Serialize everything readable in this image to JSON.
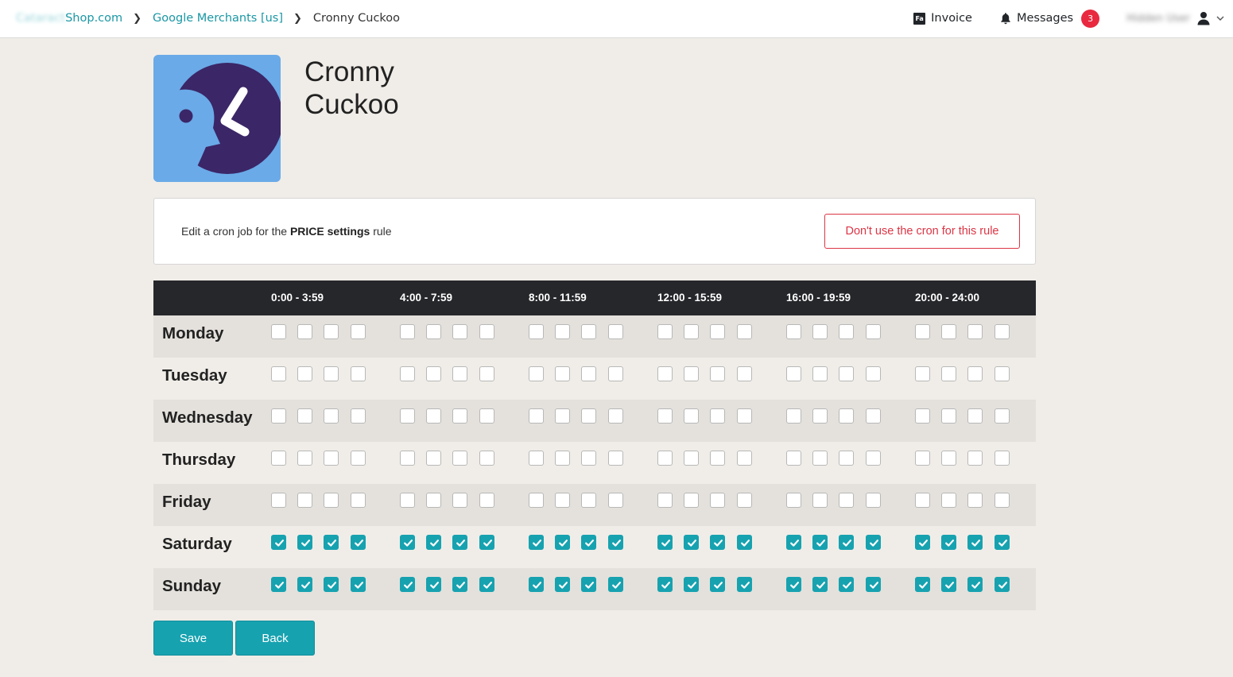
{
  "breadcrumb": {
    "shop_prefix": "Cataract",
    "shop_suffix": "Shop.com",
    "merchant": "Google Merchants [us]",
    "current": "Cronny Cuckoo"
  },
  "topnav": {
    "invoice_label": "Invoice",
    "messages_label": "Messages",
    "messages_count": "3",
    "user_name": "Hidden User"
  },
  "app": {
    "title": "Cronny Cuckoo"
  },
  "card": {
    "text_before": "Edit a cron job for the",
    "text_bold": "PRICE settings",
    "text_after": "rule",
    "disable_button": "Don't use the cron for this rule"
  },
  "schedule": {
    "time_ranges": [
      "0:00 - 3:59",
      "4:00 - 7:59",
      "8:00 - 11:59",
      "12:00 - 15:59",
      "16:00 - 19:59",
      "20:00 - 24:00"
    ],
    "days": [
      {
        "name": "Monday",
        "slots": [
          0,
          0,
          0,
          0,
          0,
          0,
          0,
          0,
          0,
          0,
          0,
          0,
          0,
          0,
          0,
          0,
          0,
          0,
          0,
          0,
          0,
          0,
          0,
          0
        ]
      },
      {
        "name": "Tuesday",
        "slots": [
          0,
          0,
          0,
          0,
          0,
          0,
          0,
          0,
          0,
          0,
          0,
          0,
          0,
          0,
          0,
          0,
          0,
          0,
          0,
          0,
          0,
          0,
          0,
          0
        ]
      },
      {
        "name": "Wednesday",
        "slots": [
          0,
          0,
          0,
          0,
          0,
          0,
          0,
          0,
          0,
          0,
          0,
          0,
          0,
          0,
          0,
          0,
          0,
          0,
          0,
          0,
          0,
          0,
          0,
          0
        ]
      },
      {
        "name": "Thursday",
        "slots": [
          0,
          0,
          0,
          0,
          0,
          0,
          0,
          0,
          0,
          0,
          0,
          0,
          0,
          0,
          0,
          0,
          0,
          0,
          0,
          0,
          0,
          0,
          0,
          0
        ]
      },
      {
        "name": "Friday",
        "slots": [
          0,
          0,
          0,
          0,
          0,
          0,
          0,
          0,
          0,
          0,
          0,
          0,
          0,
          0,
          0,
          0,
          0,
          0,
          0,
          0,
          0,
          0,
          0,
          0
        ]
      },
      {
        "name": "Saturday",
        "slots": [
          1,
          1,
          1,
          1,
          1,
          1,
          1,
          1,
          1,
          1,
          1,
          1,
          1,
          1,
          1,
          1,
          1,
          1,
          1,
          1,
          1,
          1,
          1,
          1
        ]
      },
      {
        "name": "Sunday",
        "slots": [
          1,
          1,
          1,
          1,
          1,
          1,
          1,
          1,
          1,
          1,
          1,
          1,
          1,
          1,
          1,
          1,
          1,
          1,
          1,
          1,
          1,
          1,
          1,
          1
        ]
      }
    ]
  },
  "actions": {
    "save_label": "Save",
    "back_label": "Back"
  },
  "colors": {
    "accent": "#17a2b0",
    "danger": "#dc3545",
    "header_dark": "#26272b",
    "logo_bg": "#6aaae8",
    "logo_dark": "#3b2667"
  }
}
